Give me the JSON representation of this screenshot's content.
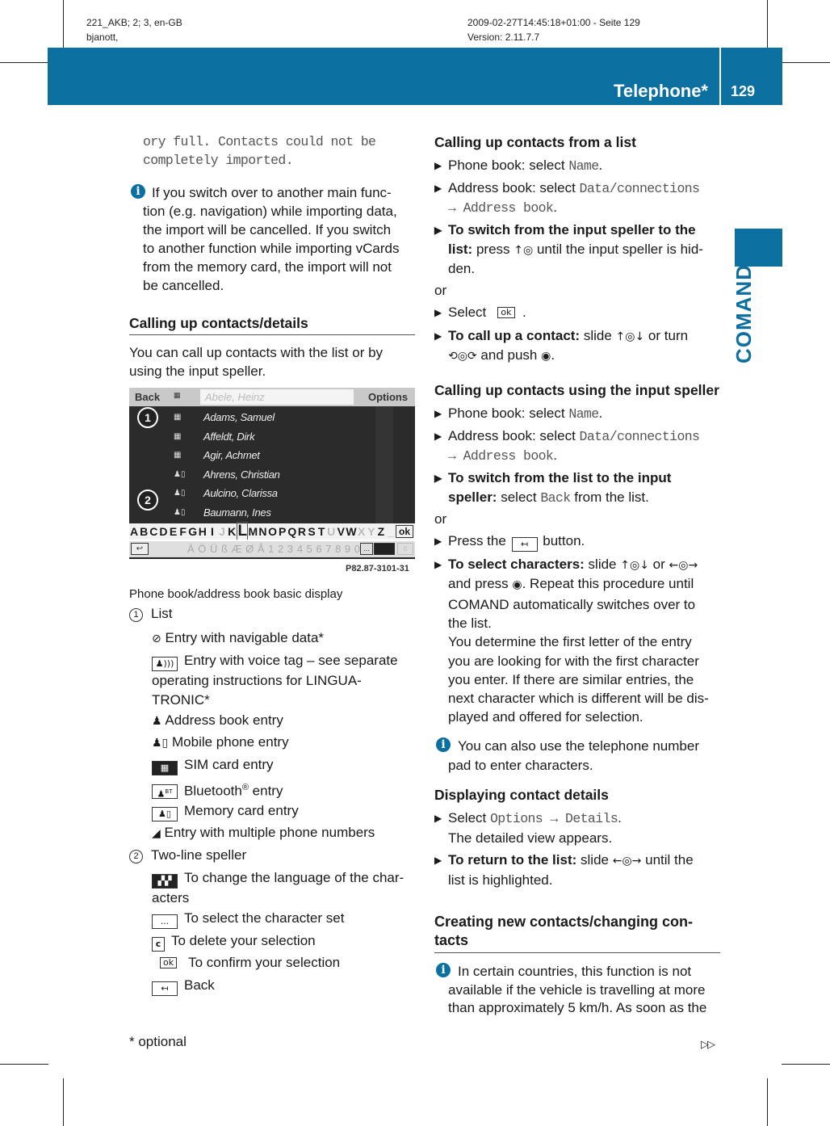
{
  "meta": {
    "left_line1": "221_AKB; 2; 3, en-GB",
    "left_line2": "bjanott,",
    "right_line1": "2009-02-27T14:45:18+01:00 - Seite 129",
    "right_line2": "Version: 2.11.7.7"
  },
  "header": {
    "title": "Telephone*",
    "page_number": "129",
    "color": "#0b6fa0"
  },
  "side_tab": "COMAND",
  "left": {
    "cont1": "ory full. Contacts could not be",
    "cont2": "completely imported.",
    "info1": [
      "If you switch over to another main func-",
      "tion (e.g. navigation) while importing data,",
      "the import will be cancelled. If you switch",
      "to another function while importing vCards",
      "from the memory card, the import will not",
      "be cancelled."
    ],
    "heading": "Calling up contacts/details",
    "intro": [
      "You can call up contacts with the list or by",
      "using the input speller."
    ],
    "screen": {
      "back": "Back",
      "field": "Abele, Heinz",
      "options": "Options",
      "rows": [
        "Adams, Samuel",
        "Affeldt, Dirk",
        "Agir, Achmet",
        "Ahrens, Christian",
        "Aulcino, Clarissa",
        "Baumann, Ines"
      ],
      "letters": [
        "A",
        "B",
        "C",
        "D",
        "E",
        "F",
        "G",
        "H",
        "I",
        "J",
        "K",
        "L",
        "M",
        "N",
        "O",
        "P",
        "Q",
        "R",
        "S",
        "T",
        "U",
        "V",
        "W",
        "X",
        "Y",
        "Z",
        "_"
      ],
      "special": "Ä Ö Ü ß Æ Ø Å 1 2 3 4 5 6 7 8 9 0",
      "ok": "ok",
      "c": "c",
      "dots": "...",
      "callout1": "1",
      "callout2": "2",
      "code": "P82.87-3101-31"
    },
    "caption": "Phone book/address book basic display",
    "legend1_num": "1",
    "legend1": "List",
    "items": {
      "nav": "Entry with navigable data*",
      "voice": [
        "Entry with voice tag – see separate",
        "operating instructions for LINGUA-",
        "TRONIC*"
      ],
      "address": "Address book entry",
      "mobile": "Mobile phone entry",
      "sim": "SIM card entry",
      "bt": "Bluetooth",
      "bt_reg": "®",
      "bt_rest": " entry",
      "bt_icon": "BT",
      "memory": "Memory card entry",
      "multi": "Entry with multiple phone numbers"
    },
    "legend2_num": "2",
    "legend2": "Two-line speller",
    "speller": {
      "lang": [
        "To change the language of the char-",
        "acters"
      ],
      "charset_key": "...",
      "charset": "To select the character set",
      "delete_key": "c",
      "delete": "To delete your selection",
      "ok_key": "ok",
      "confirm": "To confirm your selection",
      "back": "Back"
    },
    "footnote": "* optional"
  },
  "right": {
    "h1": "Calling up contacts from a list",
    "a1": "Phone book: select ",
    "a1m": "Name",
    "a2": "Address book: select ",
    "a2m": "Data/connections",
    "a2m2": "Address book",
    "a3b": "To switch from the input speller to the",
    "a3b2": "list:",
    "a3": " press ",
    "a3c": " until the input speller is hid-",
    "a3d": "den.",
    "or": "or",
    "a4": "Select",
    "a4k": "ok",
    "a5b": "To call up a contact:",
    "a5": " slide ",
    "a5c": " or turn",
    "a5d": " and push ",
    "h2": "Calling up contacts using the input speller",
    "b3b": "To switch from the list to the input",
    "b3b2": "speller:",
    "b3": " select ",
    "b3m": "Back",
    "b3c": " from the list.",
    "b4": "Press the ",
    "b4c": " button.",
    "b5b": "To select characters:",
    "b5": " slide ",
    "b5c": " or ",
    "b5d": [
      "and press ",
      ". Repeat this procedure until"
    ],
    "b5e": [
      "COMAND automatically switches over to",
      "the list.",
      "You determine the first letter of the entry",
      "you are looking for with the first character",
      "you enter. If there are similar entries, the",
      "next character which is different will be dis-",
      "played and offered for selection."
    ],
    "info2": [
      "You can also use the telephone number",
      "pad to enter characters."
    ],
    "h3": "Displaying contact details",
    "c1": "Select ",
    "c1m": "Options",
    "c1m2": "Details",
    "c1b": "The detailed view appears.",
    "c2b": "To return to the list:",
    "c2": " slide ",
    "c2c": " until the",
    "c2d": "list is highlighted.",
    "h4": [
      "Creating new contacts/changing con-",
      "tacts"
    ],
    "info3": [
      "In certain countries, this function is not",
      "available if the vehicle is travelling at more",
      "than approximately 5 km/h. As soon as the"
    ]
  },
  "continue_marker": "▷▷"
}
